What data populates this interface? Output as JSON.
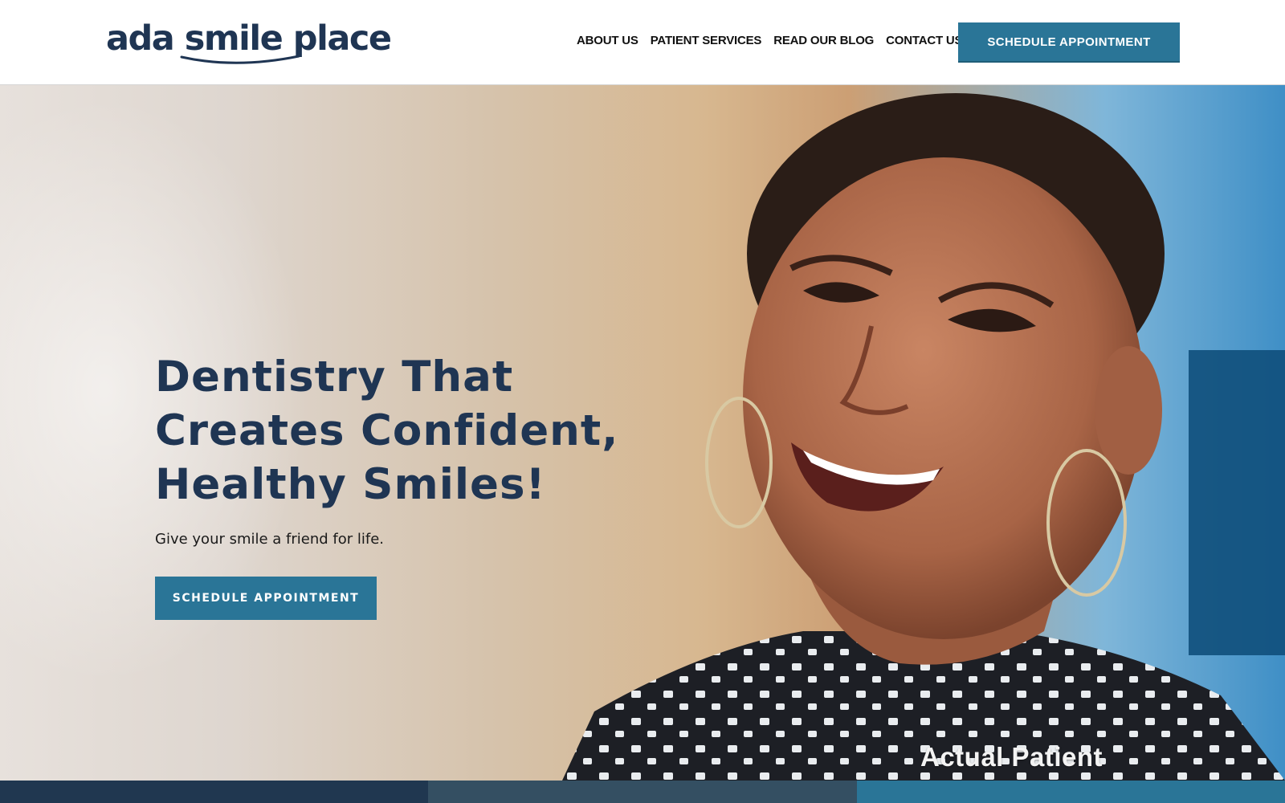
{
  "header": {
    "logo_text": "ada smile place",
    "nav": [
      {
        "label": "ABOUT US"
      },
      {
        "label": "PATIENT SERVICES"
      },
      {
        "label": "READ OUR BLOG"
      },
      {
        "label": "CONTACT US"
      }
    ],
    "cta_label": "SCHEDULE APPOINTMENT"
  },
  "hero": {
    "title_lines": [
      "Dentistry That",
      "Creates Confident,",
      "Healthy Smiles!"
    ],
    "subtitle": "Give your smile a friend for life.",
    "cta_label": "SCHEDULE APPOINTMENT",
    "badge": "Actual Patient"
  },
  "colors": {
    "brand_navy": "#1f3553",
    "accent_teal": "#2a7597",
    "bottom_bar": [
      "#203750",
      "#344f62",
      "#2a7597"
    ]
  }
}
